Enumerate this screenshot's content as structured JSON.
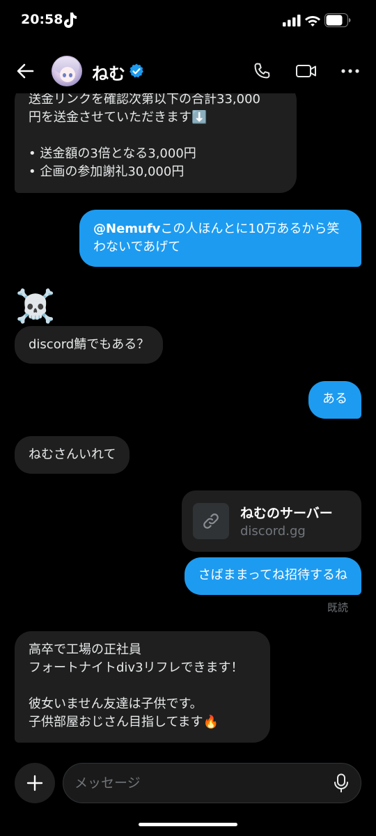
{
  "status_bar": {
    "time": "20:58"
  },
  "header": {
    "contact_name": "ねむ",
    "icons": [
      "back-arrow",
      "verified-badge",
      "phone",
      "video-camera",
      "more-dots"
    ]
  },
  "messages": [
    {
      "direction": "in",
      "text": "送金リンクを確認次第以下の合計33,000\n円を送金させていただきます⬇️\n\n• 送金額の3倍となる3,000円\n• 企画の参加謝礼30,000円"
    },
    {
      "direction": "out",
      "mention": "@Nemufv",
      "text": "この人ほんとに10万あるから笑\nわないであげて"
    },
    {
      "direction": "in",
      "text": "☠️"
    },
    {
      "direction": "in",
      "text": "discord鯖でもある？"
    },
    {
      "direction": "out",
      "text": "ある"
    },
    {
      "direction": "in",
      "text": "ねむさんいれて"
    },
    {
      "direction": "out",
      "type": "link",
      "title": "ねむのサーバー",
      "domain": "discord.gg"
    },
    {
      "direction": "out",
      "text": "さばままってね招待するね"
    },
    {
      "direction": "in",
      "text": "高卒で工場の正社員\nフォートナイトdiv3リフレできます！\n\n彼女いません友達は子供です。\n子供部屋おじさん目指してます🔥"
    }
  ],
  "read_receipt": "既読",
  "composer": {
    "placeholder": "メッセージ"
  },
  "colors": {
    "background": "#000000",
    "incoming_bubble": "#1f1f1f",
    "outgoing_bubble": "#1d9bf0",
    "verified": "#1d9bf0",
    "muted_text": "#71767b"
  }
}
